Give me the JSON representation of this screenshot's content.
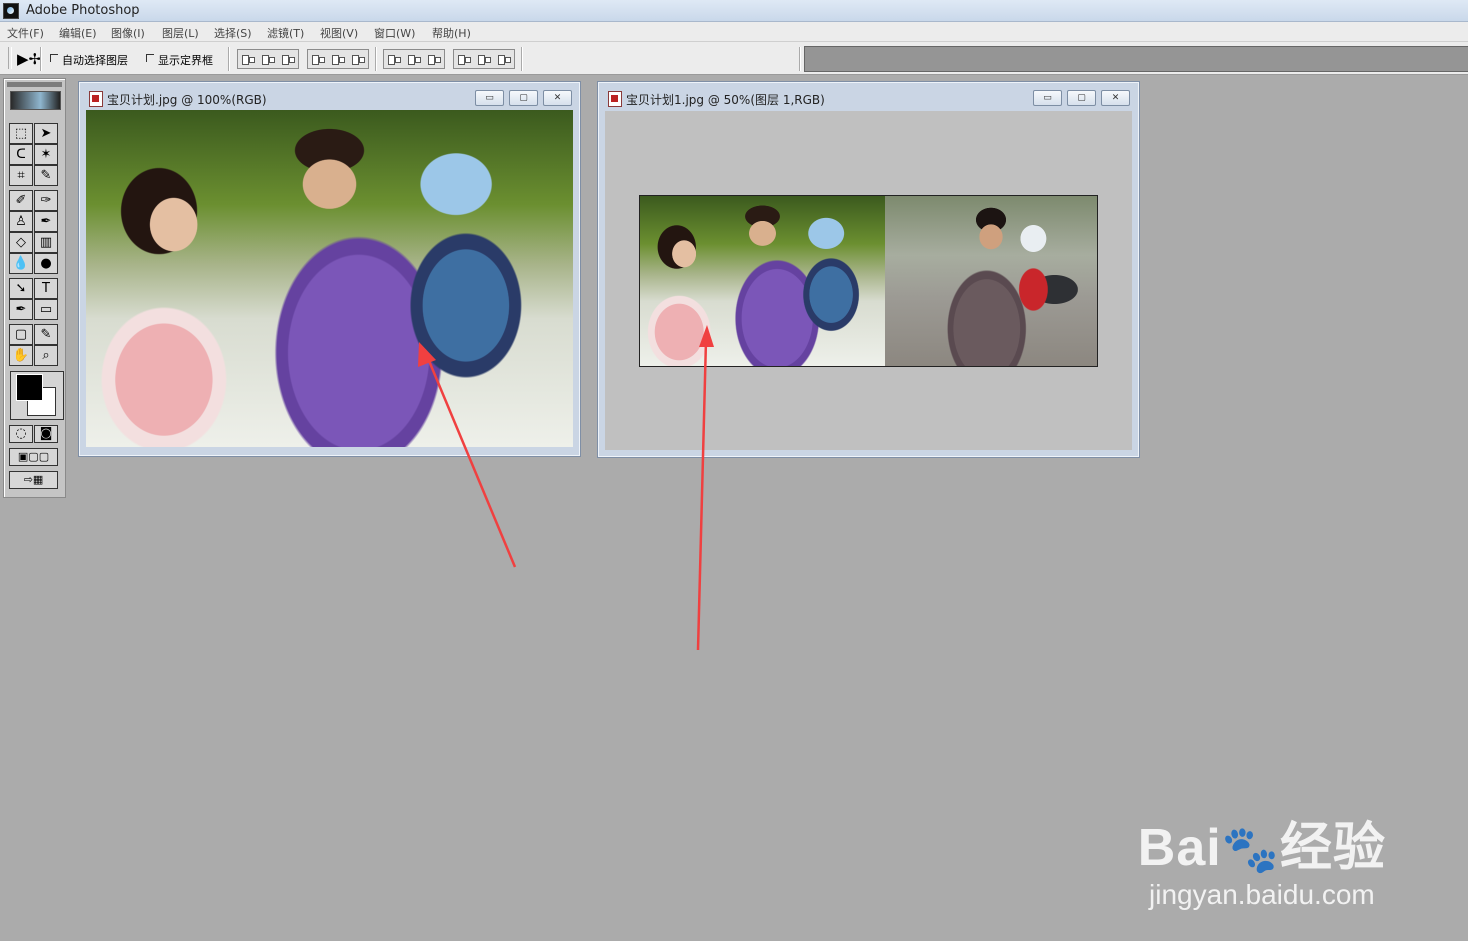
{
  "app": {
    "title": "Adobe Photoshop"
  },
  "menu": [
    "文件(F)",
    "编辑(E)",
    "图像(I)",
    "图层(L)",
    "选择(S)",
    "滤镜(T)",
    "视图(V)",
    "窗口(W)",
    "帮助(H)"
  ],
  "options": {
    "auto_select_label": "自动选择图层",
    "show_bounds_label": "显示定界框"
  },
  "toolbox": {
    "tools": [
      "marquee-icon",
      "move-icon",
      "lasso-icon",
      "magic-wand-icon",
      "crop-icon",
      "slice-icon",
      "healing-icon",
      "brush-icon",
      "clone-stamp-icon",
      "history-brush-icon",
      "eraser-icon",
      "gradient-icon",
      "blur-icon",
      "dodge-icon",
      "path-select-icon",
      "type-icon",
      "pen-icon",
      "shape-icon",
      "notes-icon",
      "eyedropper-icon",
      "hand-icon",
      "zoom-icon"
    ],
    "foreground_color": "#000000",
    "background_color": "#ffffff"
  },
  "windows": [
    {
      "title": "宝贝计划.jpg @ 100%(RGB)"
    },
    {
      "title": "宝贝计划1.jpg @ 50%(图层 1,RGB)"
    }
  ],
  "watermark": {
    "brand": "Bai",
    "brand2": "经验",
    "url": "jingyan.baidu.com"
  },
  "colors": {
    "annotation_arrow": "#f04040",
    "workspace": "#ababab"
  }
}
